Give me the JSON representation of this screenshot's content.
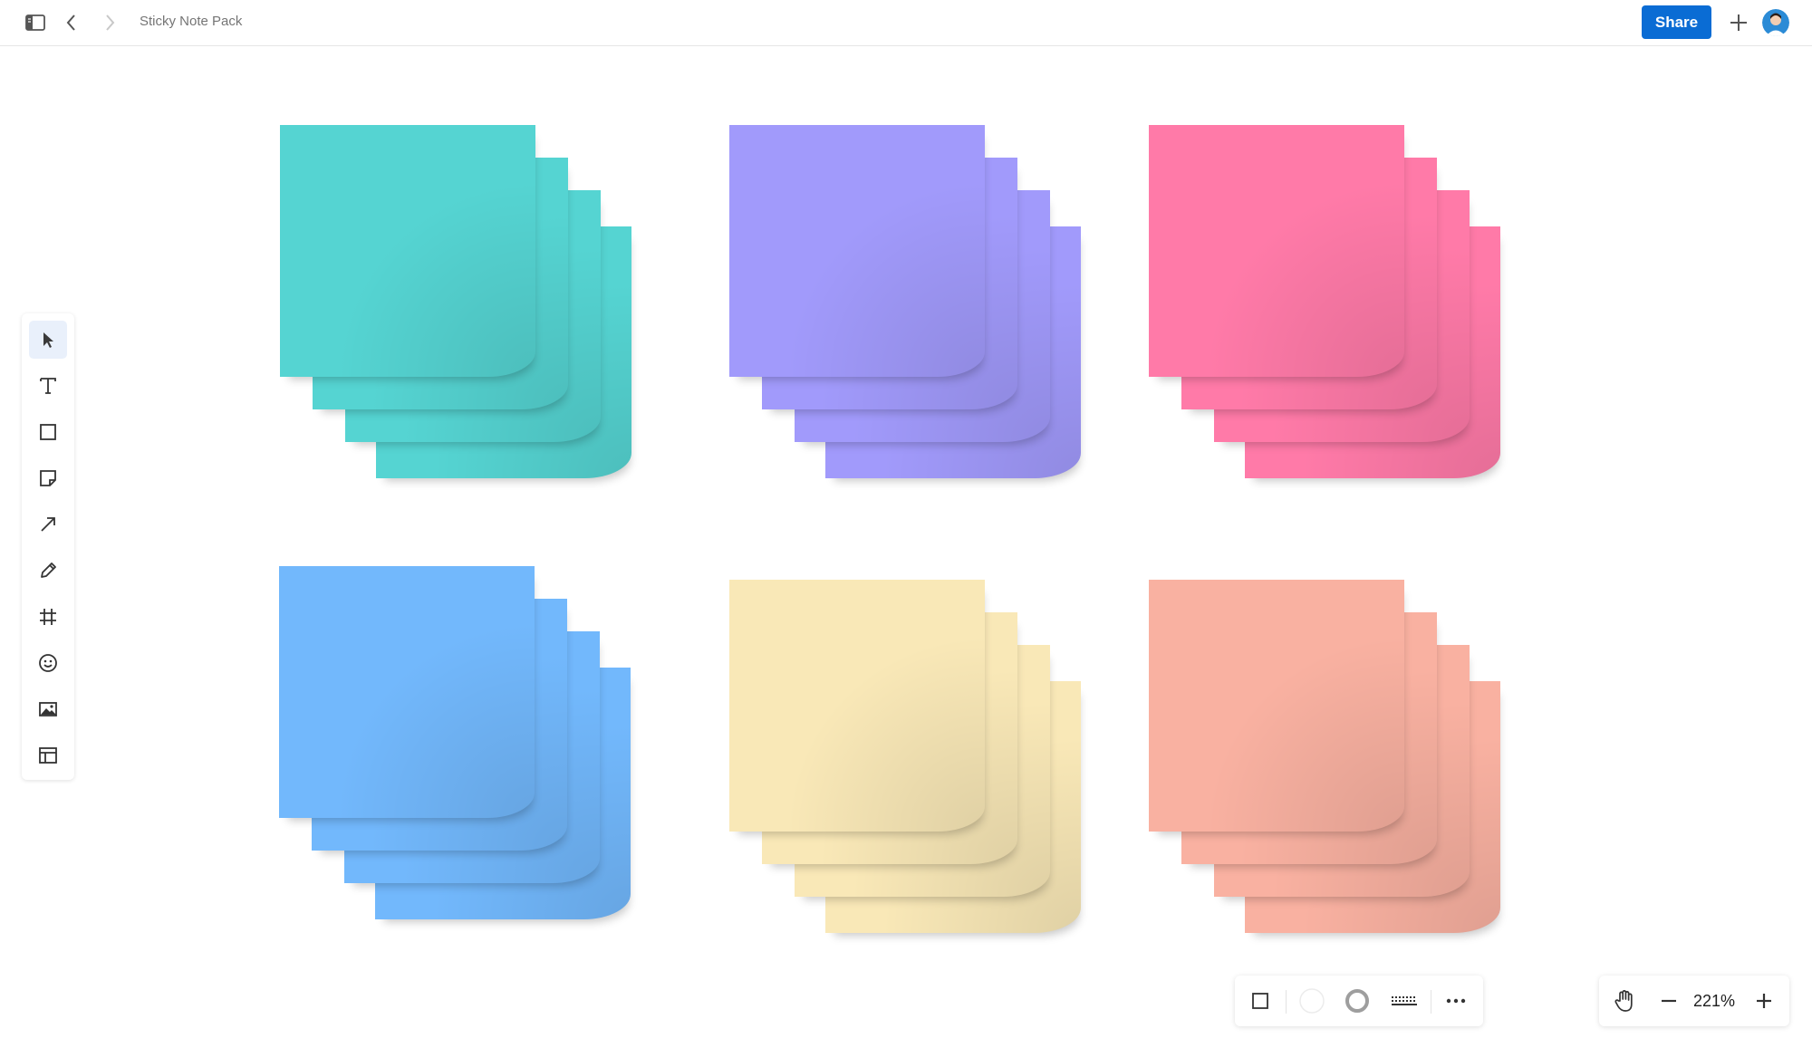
{
  "header": {
    "sidebar_toggle": "sidebar-toggle-icon",
    "back": "chevron-left-icon",
    "forward": "chevron-right-icon",
    "document_title": "Sticky Note Pack",
    "share_label": "Share",
    "add": "plus-icon",
    "avatar": "user-avatar",
    "accent_color": "#0a6cd4"
  },
  "tools": [
    {
      "id": "select",
      "icon": "pointer-icon",
      "active": true
    },
    {
      "id": "text",
      "icon": "text-icon"
    },
    {
      "id": "rectangle",
      "icon": "square-icon"
    },
    {
      "id": "sticky",
      "icon": "sticky-note-icon"
    },
    {
      "id": "arrow",
      "icon": "arrow-icon"
    },
    {
      "id": "pen",
      "icon": "pencil-icon"
    },
    {
      "id": "frame",
      "icon": "frame-icon"
    },
    {
      "id": "emoji",
      "icon": "smiley-icon"
    },
    {
      "id": "image",
      "icon": "image-icon"
    },
    {
      "id": "template",
      "icon": "layout-icon"
    }
  ],
  "sticky_packs": [
    {
      "color": "#55d4d2"
    },
    {
      "color": "#a19afb"
    },
    {
      "color": "#ff7aa8"
    },
    {
      "color": "#72b8fc"
    },
    {
      "color": "#f9e8b7"
    },
    {
      "color": "#f9b1a1"
    }
  ],
  "bottom_toolbar": {
    "items": [
      "square-icon",
      "fill-circle-icon",
      "stroke-circle-icon",
      "keyboard-icon",
      "more-icon"
    ]
  },
  "zoom": {
    "hand": "hand-icon",
    "minus": "minus-icon",
    "level": "221%",
    "plus": "plus-icon"
  }
}
